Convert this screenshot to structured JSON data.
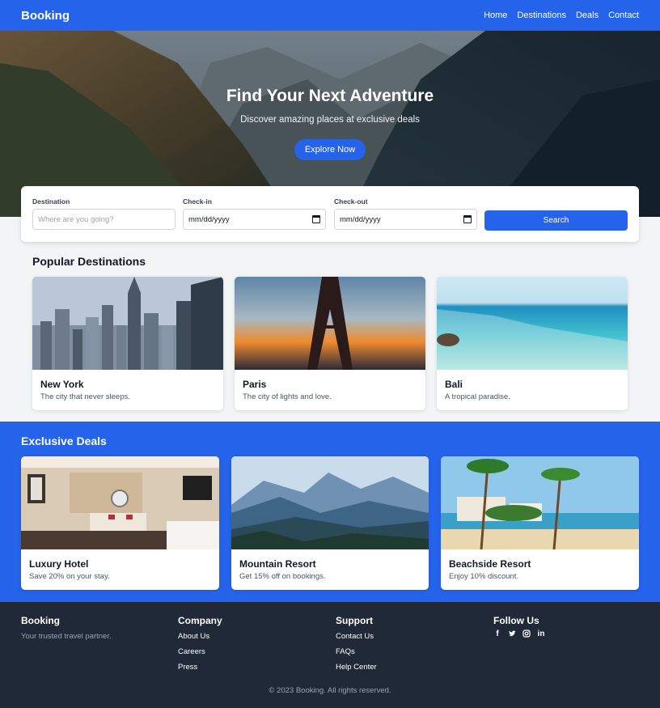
{
  "nav": {
    "brand": "Booking",
    "links": [
      "Home",
      "Destinations",
      "Deals",
      "Contact"
    ]
  },
  "hero": {
    "title": "Find Your Next Adventure",
    "subtitle": "Discover amazing places at exclusive deals",
    "cta": "Explore Now"
  },
  "search": {
    "destination_label": "Destination",
    "destination_placeholder": "Where are you going?",
    "checkin_label": "Check-in",
    "checkin_value": "mm/dd/yyyy",
    "checkout_label": "Check-out",
    "checkout_value": "mm/dd/yyyy",
    "button": "Search"
  },
  "popular": {
    "title": "Popular Destinations",
    "items": [
      {
        "name": "New York",
        "desc": "The city that never sleeps."
      },
      {
        "name": "Paris",
        "desc": "The city of lights and love."
      },
      {
        "name": "Bali",
        "desc": "A tropical paradise."
      }
    ]
  },
  "deals": {
    "title": "Exclusive Deals",
    "items": [
      {
        "name": "Luxury Hotel",
        "desc": "Save 20% on your stay."
      },
      {
        "name": "Mountain Resort",
        "desc": "Get 15% off on bookings."
      },
      {
        "name": "Beachside Resort",
        "desc": "Enjoy 10% discount."
      }
    ]
  },
  "footer": {
    "brand": "Booking",
    "tagline": "Your trusted travel partner.",
    "company_title": "Company",
    "company_links": [
      "About Us",
      "Careers",
      "Press"
    ],
    "support_title": "Support",
    "support_links": [
      "Contact Us",
      "FAQs",
      "Help Center"
    ],
    "follow_title": "Follow Us",
    "social": [
      {
        "icon": "facebook-icon",
        "glyph": "f"
      },
      {
        "icon": "twitter-icon",
        "glyph": "🐦"
      },
      {
        "icon": "instagram-icon",
        "glyph": "◎"
      },
      {
        "icon": "linkedin-icon",
        "glyph": "in"
      }
    ],
    "copyright": "© 2023 Booking. All rights reserved."
  },
  "colors": {
    "primary": "#2563eb",
    "footer_bg": "#1f2937",
    "page_bg": "#f3f4f6"
  }
}
